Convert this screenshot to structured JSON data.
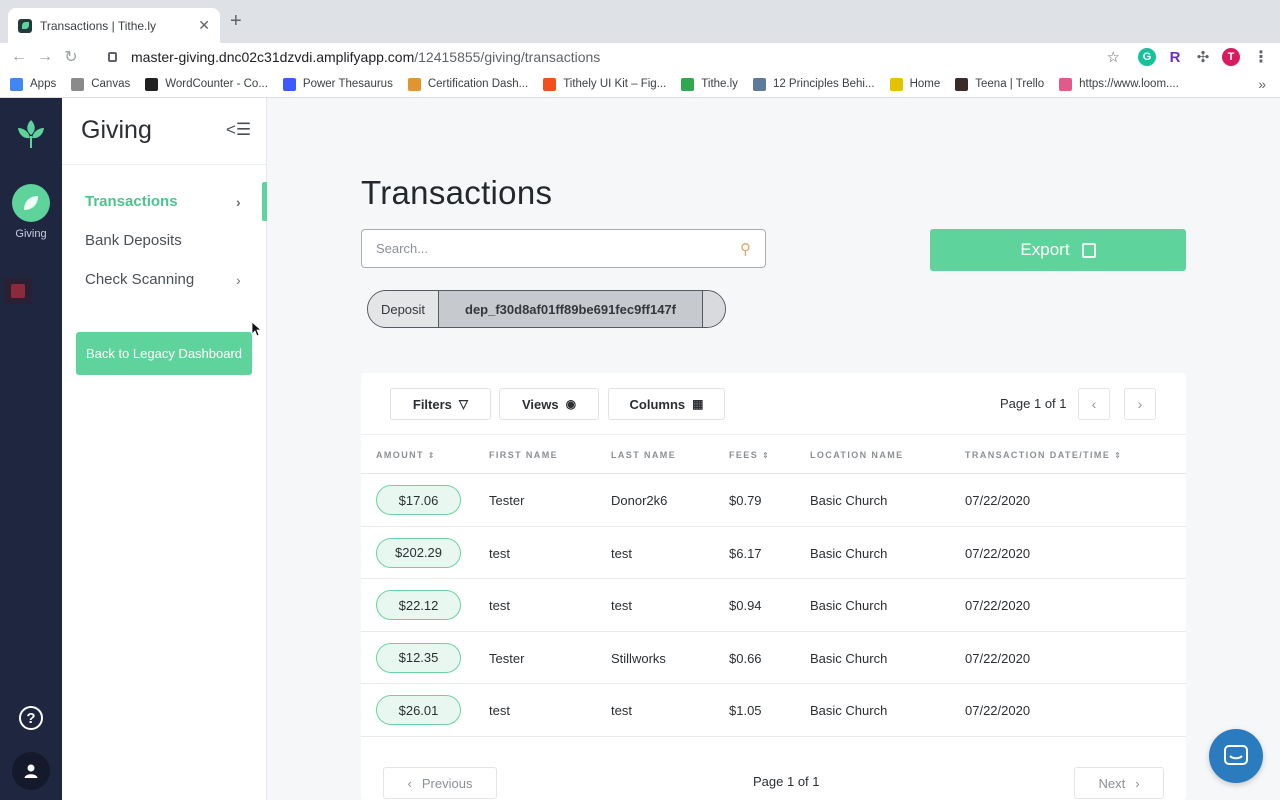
{
  "browser": {
    "tab_title": "Transactions | Tithe.ly",
    "url_host": "master-giving.dnc02c31dzvdi.amplifyapp.com",
    "url_path": "/12415855/giving/transactions",
    "avatar_letter": "T",
    "bookmarks": [
      {
        "label": "Apps",
        "icon": "apps-grid-icon",
        "color": "#4285f4"
      },
      {
        "label": "Canvas",
        "icon": "canvas-icon",
        "color": "#8a8a8a"
      },
      {
        "label": "WordCounter - Co...",
        "icon": "w-icon",
        "color": "#222222"
      },
      {
        "label": "Power Thesaurus",
        "icon": "power-thesaurus-icon",
        "color": "#3d5afe"
      },
      {
        "label": "Certification Dash...",
        "icon": "certification-icon",
        "color": "#e0952f"
      },
      {
        "label": "Tithely UI Kit – Fig...",
        "icon": "figma-icon",
        "color": "#f24e1e"
      },
      {
        "label": "Tithe.ly",
        "icon": "tithely-icon",
        "color": "#2fa84f"
      },
      {
        "label": "12 Principles Behi...",
        "icon": "principles-icon",
        "color": "#5d7a9c"
      },
      {
        "label": "Home",
        "icon": "home-icon",
        "color": "#e3c300"
      },
      {
        "label": "Teena | Trello",
        "icon": "trello-icon",
        "color": "#3b2a2a"
      },
      {
        "label": "https://www.loom....",
        "icon": "loom-icon",
        "color": "#e05a8a"
      }
    ]
  },
  "rail": {
    "giving_label": "Giving"
  },
  "sidebar": {
    "title": "Giving",
    "items": [
      {
        "label": "Transactions",
        "active": true,
        "chevron": true
      },
      {
        "label": "Bank Deposits",
        "active": false,
        "chevron": false
      },
      {
        "label": "Check Scanning",
        "active": false,
        "chevron": true
      }
    ],
    "legacy_button": "Back to Legacy Dashboard"
  },
  "main": {
    "title": "Transactions",
    "search_placeholder": "Search...",
    "export_label": "Export",
    "filter_chip": {
      "key": "Deposit",
      "value": "dep_f30d8af01ff89be691fec9ff147f"
    },
    "toolbar": {
      "filters_label": "Filters",
      "views_label": "Views",
      "columns_label": "Columns",
      "page_text": "Page 1 of 1"
    },
    "columns": [
      "AMOUNT",
      "FIRST NAME",
      "LAST NAME",
      "FEES",
      "LOCATION NAME",
      "TRANSACTION DATE/TIME"
    ],
    "rows": [
      {
        "amount": "$17.06",
        "first": "Tester",
        "last": "Donor2k6",
        "fees": "$0.79",
        "location": "Basic Church",
        "date": "07/22/2020"
      },
      {
        "amount": "$202.29",
        "first": "test",
        "last": "test",
        "fees": "$6.17",
        "location": "Basic Church",
        "date": "07/22/2020"
      },
      {
        "amount": "$22.12",
        "first": "test",
        "last": "test",
        "fees": "$0.94",
        "location": "Basic Church",
        "date": "07/22/2020"
      },
      {
        "amount": "$12.35",
        "first": "Tester",
        "last": "Stillworks",
        "fees": "$0.66",
        "location": "Basic Church",
        "date": "07/22/2020"
      },
      {
        "amount": "$26.01",
        "first": "test",
        "last": "test",
        "fees": "$1.05",
        "location": "Basic Church",
        "date": "07/22/2020"
      }
    ],
    "footer": {
      "previous_label": "Previous",
      "next_label": "Next",
      "page_text": "Page 1 of 1"
    }
  },
  "colors": {
    "accent": "#5ed39b",
    "rail_bg": "#1f2640",
    "chat_bubble": "#2b7bbf"
  }
}
